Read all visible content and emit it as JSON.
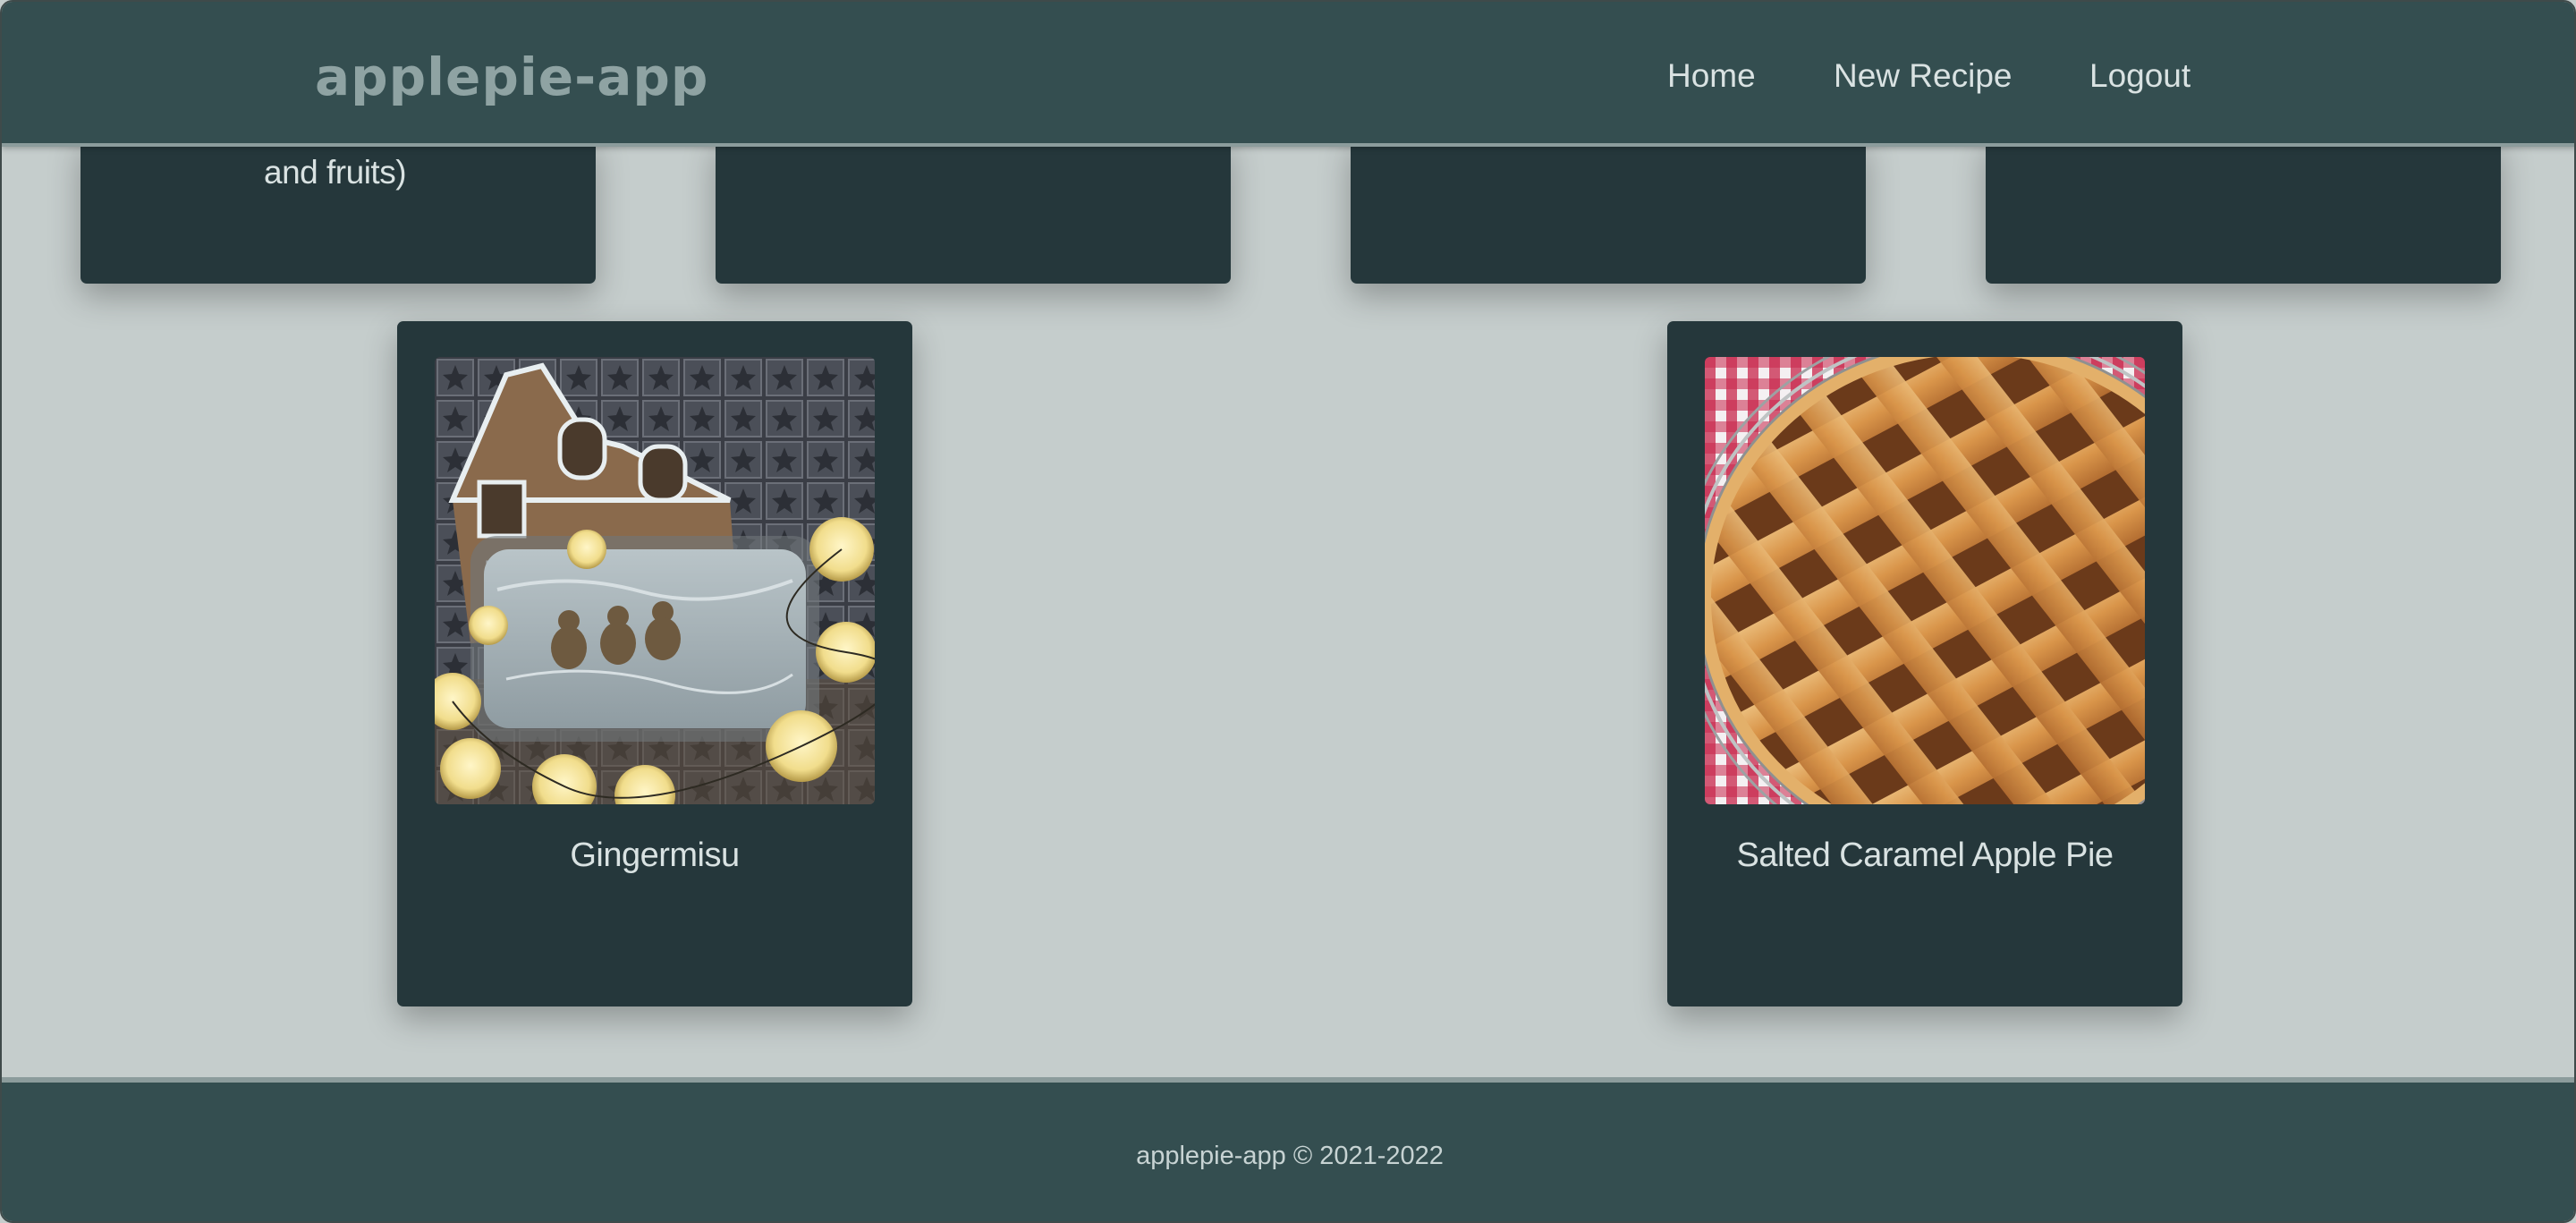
{
  "header": {
    "brand": "applepie-app",
    "nav": {
      "home": "Home",
      "new_recipe": "New Recipe",
      "logout": "Logout"
    }
  },
  "top_row": {
    "card1_partial_title": "and fruits)"
  },
  "recipes": [
    {
      "title": "Gingermisu",
      "image": "gingerbread-tiramisu-photo"
    },
    {
      "title": "Salted Caramel Apple Pie",
      "image": "lattice-apple-pie-photo"
    }
  ],
  "footer": {
    "copyright": "applepie-app © 2021-2022"
  },
  "colors": {
    "page_bg": "#c5cdcc",
    "header_bg": "#344e50",
    "card_bg": "#25373b",
    "text_light": "#d9e2e2",
    "logo": "#8fa3a3"
  }
}
